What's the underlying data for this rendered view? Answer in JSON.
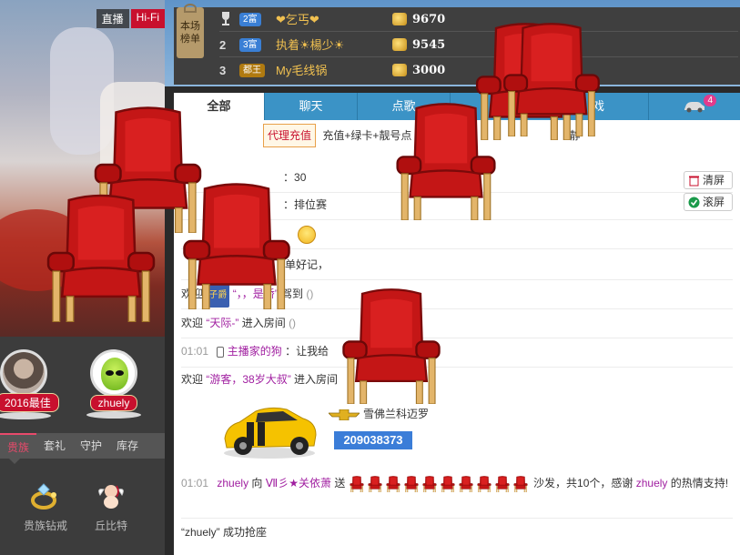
{
  "video": {
    "tag_live": "直播",
    "tag_hifi": "Hi-Fi"
  },
  "avatars": [
    {
      "name": "2016最佳"
    },
    {
      "name": "zhuely"
    }
  ],
  "left_tabs": [
    "贵族",
    "套礼",
    "守护",
    "库存"
  ],
  "gifts": [
    {
      "label": "贵族钻戒",
      "icon": "ring-icon"
    },
    {
      "label": "丘比特",
      "icon": "cupid-icon"
    }
  ],
  "rank": {
    "badge": "本场榜单",
    "rows": [
      {
        "pos": "",
        "level": "2富",
        "level_color": "#3a7fd5",
        "nick": "❤乞丐❤",
        "amount": "9670"
      },
      {
        "pos": "2",
        "level": "3富",
        "level_color": "#3a7fd5",
        "nick": "执着☀楊少☀",
        "amount": "9545"
      },
      {
        "pos": "3",
        "level": "都王",
        "level_color": "#b07a10",
        "nick": "My毛线锅",
        "amount": "3000"
      }
    ]
  },
  "tabs": [
    {
      "label": "全部",
      "active": true
    },
    {
      "label": "聊天"
    },
    {
      "label": "点歌"
    },
    {
      "label": ""
    },
    {
      "label": "戏"
    },
    {
      "label": "",
      "icon": "car-icon",
      "badge": "4"
    }
  ],
  "chat": {
    "agent_btn": "代理充值",
    "promo": "充值+绿卡+靓号点",
    "promo_tail": "静",
    "line_score": "30",
    "line_rank": "排位赛",
    "line_remember": "单好记，",
    "line_welcome1_prefix": "欢迎",
    "line_welcome1_level": "子爵",
    "line_welcome1_name": "“，，是骄”",
    "line_welcome1_suffix": "驾到",
    "line_welcome2_prefix": "欢迎",
    "line_welcome2_name": "“天际-”",
    "line_welcome2_suffix": "进入房间",
    "line_msg_time": "01:01",
    "line_msg_name": "主播家的狗",
    "line_msg_text": "：让我给",
    "line_welcome3_prefix": "欢迎",
    "line_welcome3_name": "“游客，38岁大叔”",
    "line_welcome3_suffix": "进入房间",
    "car_name": "雪佛兰科迈罗",
    "car_id": "209038373",
    "gift_time": "01:01",
    "gift_from": "zhuely",
    "gift_to_prefix": "向",
    "gift_to": "Ⅶ彡★关依萧",
    "gift_send": "送",
    "gift_text": "沙发，共10个，感谢",
    "gift_thanks_name": "zhuely",
    "gift_thanks_suffix": "的热情支持!",
    "seat_line": "“zhuely” 成功抢座",
    "btn_clear": "清屏",
    "btn_scroll": "滚屏"
  },
  "colors": {
    "tab_blue": "#3b93c6",
    "brand_red": "#c8102e",
    "name_purple": "#a01ea0"
  }
}
